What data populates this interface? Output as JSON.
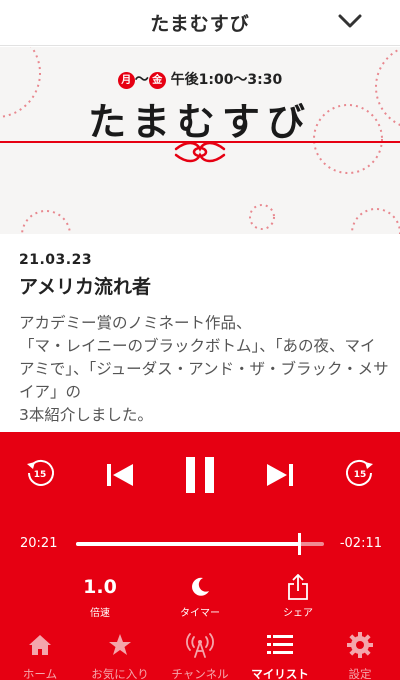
{
  "header": {
    "title": "たまむすび",
    "close_icon": "chevron-down-icon"
  },
  "banner": {
    "day_start": "月",
    "day_separator": "〜",
    "day_end": "金",
    "time": "午後1:00〜3:30",
    "logo": "たまむすび",
    "accent_color": "#e60012"
  },
  "episode": {
    "date": "21.03.23",
    "title": "アメリカ流れ者",
    "description": "アカデミー賞のノミネート作品、\n「マ・レイニーのブラックボトム」、「あの夜、マイアミで」、「ジューダス・アンド・ザ・ブラック・メサイア」の\n3本紹介しました。"
  },
  "player": {
    "rewind_seconds": "15",
    "forward_seconds": "15",
    "elapsed": "20:21",
    "remaining": "-02:11",
    "progress": 0.9,
    "speed_value": "1.0",
    "speed_label": "倍速",
    "timer_label": "タイマー",
    "share_label": "シェア",
    "background_color": "#e60012"
  },
  "nav": {
    "tabs": [
      {
        "label": "ホーム",
        "icon": "home-icon"
      },
      {
        "label": "お気に入り",
        "icon": "star-icon"
      },
      {
        "label": "チャンネル",
        "icon": "antenna-icon"
      },
      {
        "label": "マイリスト",
        "icon": "list-icon",
        "active": true
      },
      {
        "label": "設定",
        "icon": "gear-icon"
      }
    ]
  }
}
